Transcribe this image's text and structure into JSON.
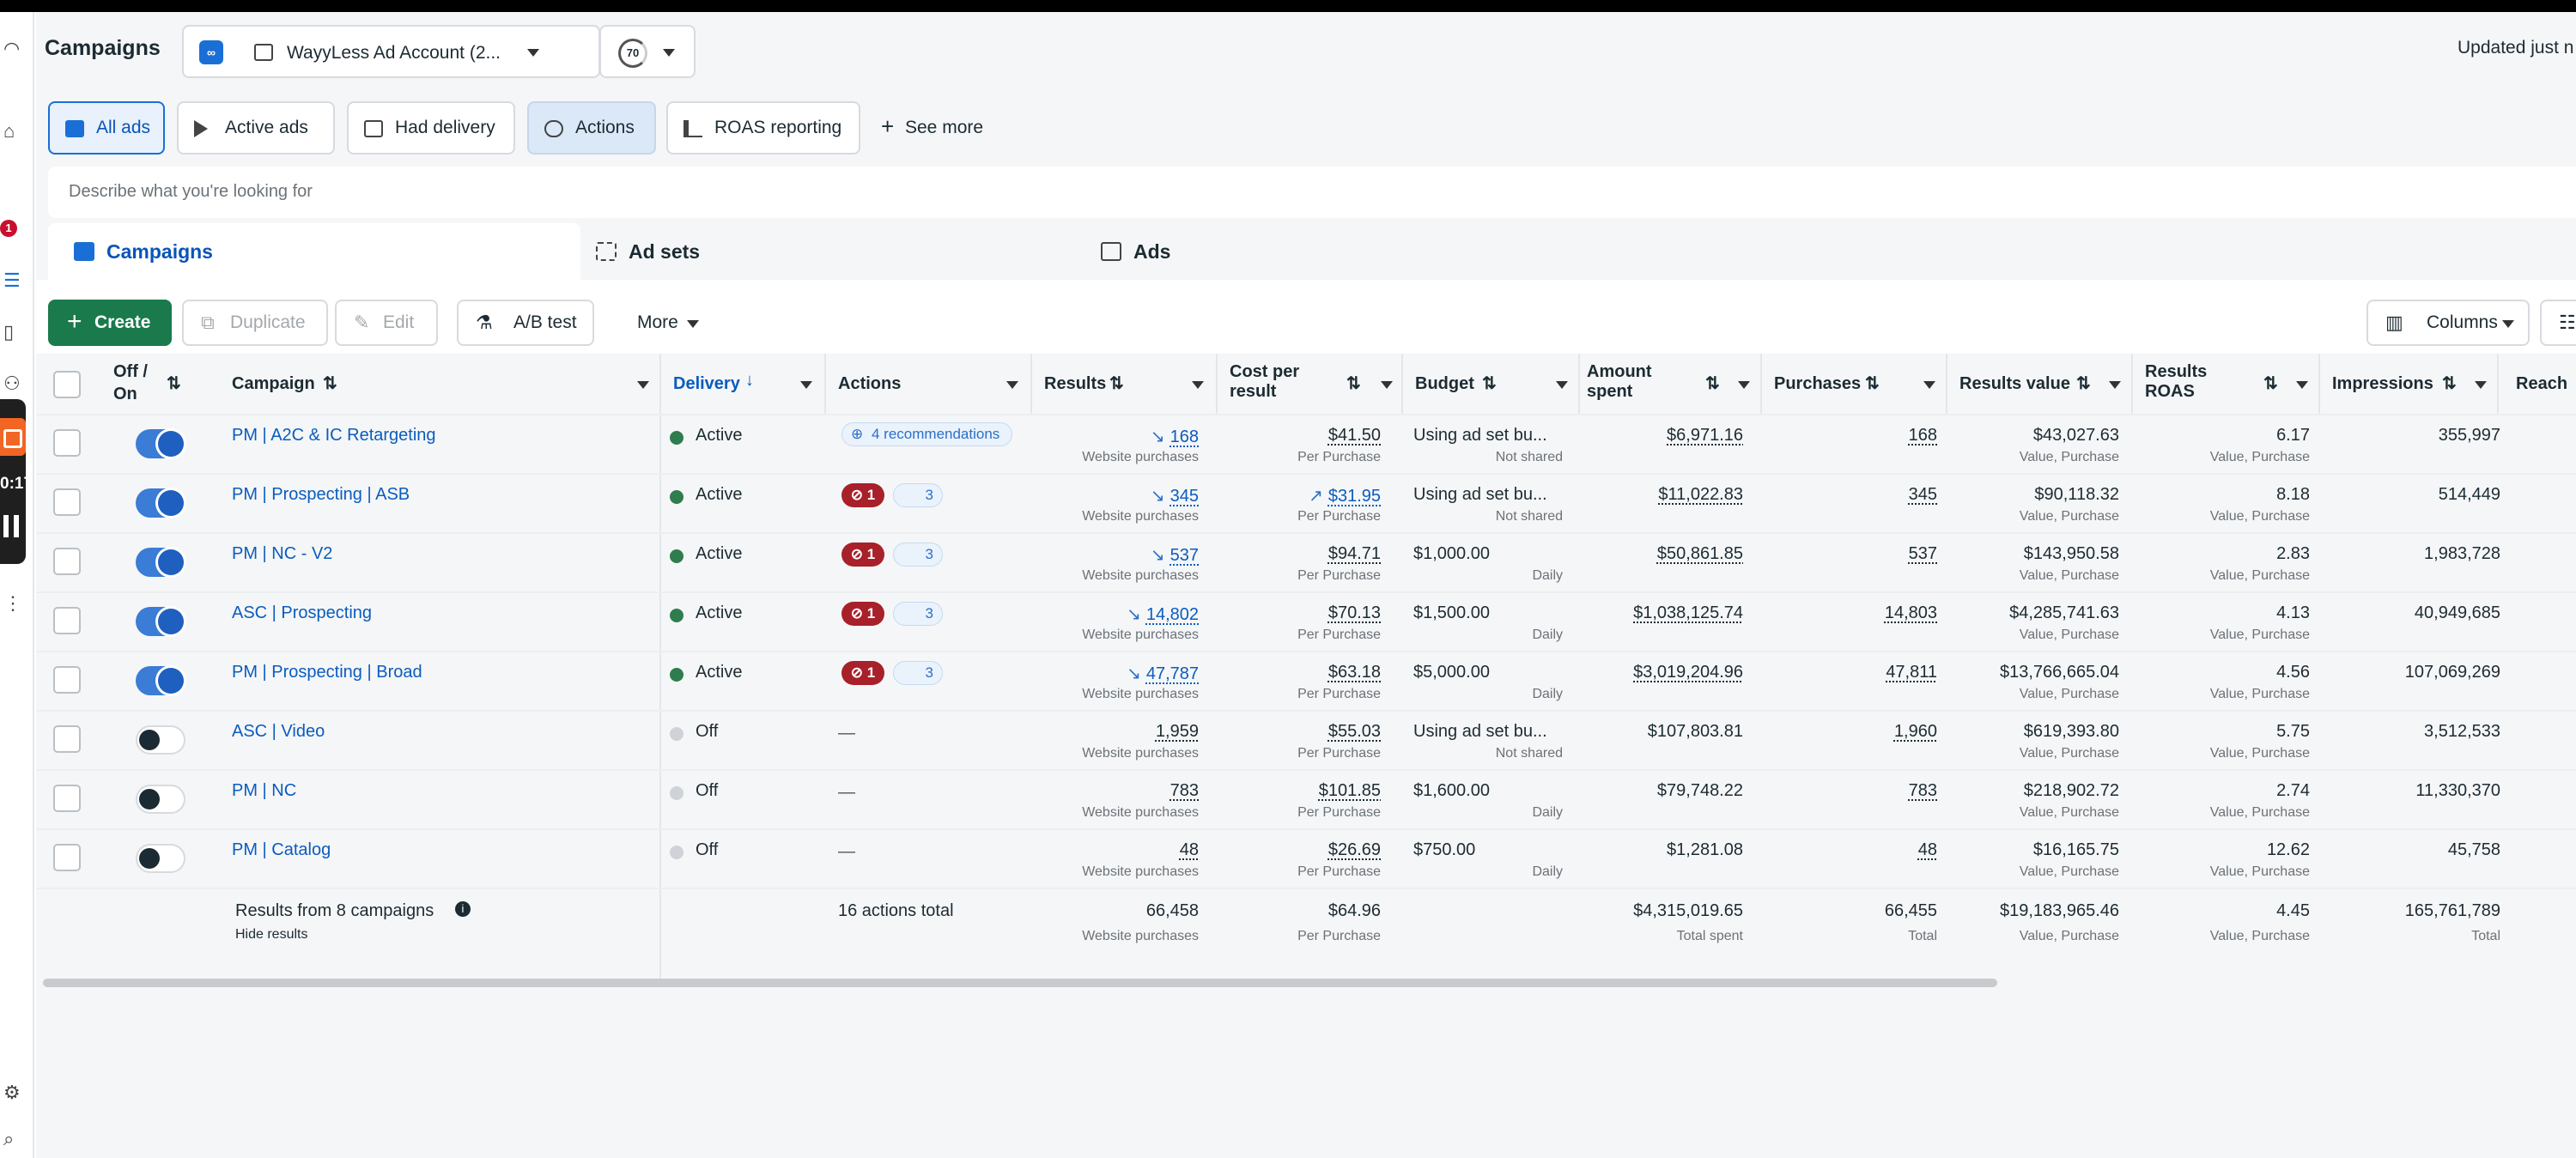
{
  "header": {
    "title": "Campaigns",
    "account_name": "WayyLess Ad Account (2...",
    "account_score": "70",
    "updated": "Updated just n"
  },
  "recorder": {
    "time": "0:17"
  },
  "rail": {
    "badge": "1"
  },
  "chips": [
    {
      "label": "All ads"
    },
    {
      "label": "Active ads"
    },
    {
      "label": "Had delivery"
    },
    {
      "label": "Actions"
    },
    {
      "label": "ROAS reporting"
    },
    {
      "label": "See more"
    }
  ],
  "search": {
    "placeholder": "Describe what you're looking for"
  },
  "level_tabs": {
    "campaigns": "Campaigns",
    "adsets": "Ad sets",
    "ads": "Ads"
  },
  "toolbar": {
    "create": "Create",
    "duplicate": "Duplicate",
    "edit": "Edit",
    "abtest": "A/B test",
    "more": "More",
    "columns": "Columns"
  },
  "table": {
    "headers": {
      "offon": "Off / On",
      "campaign": "Campaign",
      "delivery": "Delivery",
      "actions": "Actions",
      "results": "Results",
      "cpr1": "Cost per",
      "cpr2": "result",
      "budget": "Budget",
      "amount1": "Amount",
      "amount2": "spent",
      "purchases": "Purchases",
      "results_value": "Results value",
      "roas1": "Results",
      "roas2": "ROAS",
      "impressions": "Impressions",
      "reach": "Reach"
    },
    "rows": [
      {
        "name": "PM | A2C & IC Retargeting",
        "on": true,
        "delivery": "Active",
        "actions": "4 recommendations",
        "err": "",
        "num": "",
        "results": "168",
        "results_sub": "Website purchases",
        "cpr": "$41.50",
        "cpr_sub": "Per Purchase",
        "budget": "Using ad set bu...",
        "budget_sub": "Not shared",
        "spent": "$6,971.16",
        "purchases": "168",
        "value": "$43,027.63",
        "value_sub": "Value, Purchase",
        "roas": "6.17",
        "roas_sub": "Value, Purchase",
        "impressions": "355,997"
      },
      {
        "name": "PM | Prospecting | ASB",
        "on": true,
        "delivery": "Active",
        "actions": "",
        "err": "1",
        "num": "3",
        "results": "345",
        "results_sub": "Website purchases",
        "cpr": "$31.95",
        "cpr_sub": "Per Purchase",
        "budget": "Using ad set bu...",
        "budget_sub": "Not shared",
        "spent": "$11,022.83",
        "purchases": "345",
        "value": "$90,118.32",
        "value_sub": "Value, Purchase",
        "roas": "8.18",
        "roas_sub": "Value, Purchase",
        "impressions": "514,449"
      },
      {
        "name": "PM | NC - V2",
        "on": true,
        "delivery": "Active",
        "actions": "",
        "err": "1",
        "num": "3",
        "results": "537",
        "results_sub": "Website purchases",
        "cpr": "$94.71",
        "cpr_sub": "Per Purchase",
        "budget": "$1,000.00",
        "budget_sub": "Daily",
        "spent": "$50,861.85",
        "purchases": "537",
        "value": "$143,950.58",
        "value_sub": "Value, Purchase",
        "roas": "2.83",
        "roas_sub": "Value, Purchase",
        "impressions": "1,983,728"
      },
      {
        "name": "ASC | Prospecting",
        "on": true,
        "delivery": "Active",
        "actions": "",
        "err": "1",
        "num": "3",
        "results": "14,802",
        "results_sub": "Website purchases",
        "cpr": "$70.13",
        "cpr_sub": "Per Purchase",
        "budget": "$1,500.00",
        "budget_sub": "Daily",
        "spent": "$1,038,125.74",
        "purchases": "14,803",
        "value": "$4,285,741.63",
        "value_sub": "Value, Purchase",
        "roas": "4.13",
        "roas_sub": "Value, Purchase",
        "impressions": "40,949,685"
      },
      {
        "name": "PM | Prospecting | Broad",
        "on": true,
        "delivery": "Active",
        "actions": "",
        "err": "1",
        "num": "3",
        "results": "47,787",
        "results_sub": "Website purchases",
        "cpr": "$63.18",
        "cpr_sub": "Per Purchase",
        "budget": "$5,000.00",
        "budget_sub": "Daily",
        "spent": "$3,019,204.96",
        "purchases": "47,811",
        "value": "$13,766,665.04",
        "value_sub": "Value, Purchase",
        "roas": "4.56",
        "roas_sub": "Value, Purchase",
        "impressions": "107,069,269"
      },
      {
        "name": "ASC | Video",
        "on": false,
        "delivery": "Off",
        "actions": "—",
        "err": "",
        "num": "",
        "results": "1,959",
        "results_sub": "Website purchases",
        "cpr": "$55.03",
        "cpr_sub": "Per Purchase",
        "budget": "Using ad set bu...",
        "budget_sub": "Not shared",
        "spent": "$107,803.81",
        "purchases": "1,960",
        "value": "$619,393.80",
        "value_sub": "Value, Purchase",
        "roas": "5.75",
        "roas_sub": "Value, Purchase",
        "impressions": "3,512,533"
      },
      {
        "name": "PM | NC",
        "on": false,
        "delivery": "Off",
        "actions": "—",
        "err": "",
        "num": "",
        "results": "783",
        "results_sub": "Website purchases",
        "cpr": "$101.85",
        "cpr_sub": "Per Purchase",
        "budget": "$1,600.00",
        "budget_sub": "Daily",
        "spent": "$79,748.22",
        "purchases": "783",
        "value": "$218,902.72",
        "value_sub": "Value, Purchase",
        "roas": "2.74",
        "roas_sub": "Value, Purchase",
        "impressions": "11,330,370"
      },
      {
        "name": "PM | Catalog",
        "on": false,
        "delivery": "Off",
        "actions": "—",
        "err": "",
        "num": "",
        "results": "48",
        "results_sub": "Website purchases",
        "cpr": "$26.69",
        "cpr_sub": "Per Purchase",
        "budget": "$750.00",
        "budget_sub": "Daily",
        "spent": "$1,281.08",
        "purchases": "48",
        "value": "$16,165.75",
        "value_sub": "Value, Purchase",
        "roas": "12.62",
        "roas_sub": "Value, Purchase",
        "impressions": "45,758"
      }
    ],
    "totals": {
      "label": "Results from 8 campaigns",
      "hide": "Hide results",
      "actions": "16 actions total",
      "results": "66,458",
      "results_sub": "Website purchases",
      "cpr": "$64.96",
      "cpr_sub": "Per Purchase",
      "spent": "$4,315,019.65",
      "spent_sub": "Total spent",
      "purchases": "66,455",
      "purchases_sub": "Total",
      "value": "$19,183,965.46",
      "value_sub": "Value, Purchase",
      "roas": "4.45",
      "roas_sub": "Value, Purchase",
      "impressions": "165,761,789",
      "impressions_sub": "Total"
    }
  },
  "colors": {
    "accent": "#1a6fd7",
    "create": "#1a7a4c",
    "active_dot": "#2f7d4f",
    "off_dot": "#cfd2d6",
    "error": "#a8202a"
  }
}
